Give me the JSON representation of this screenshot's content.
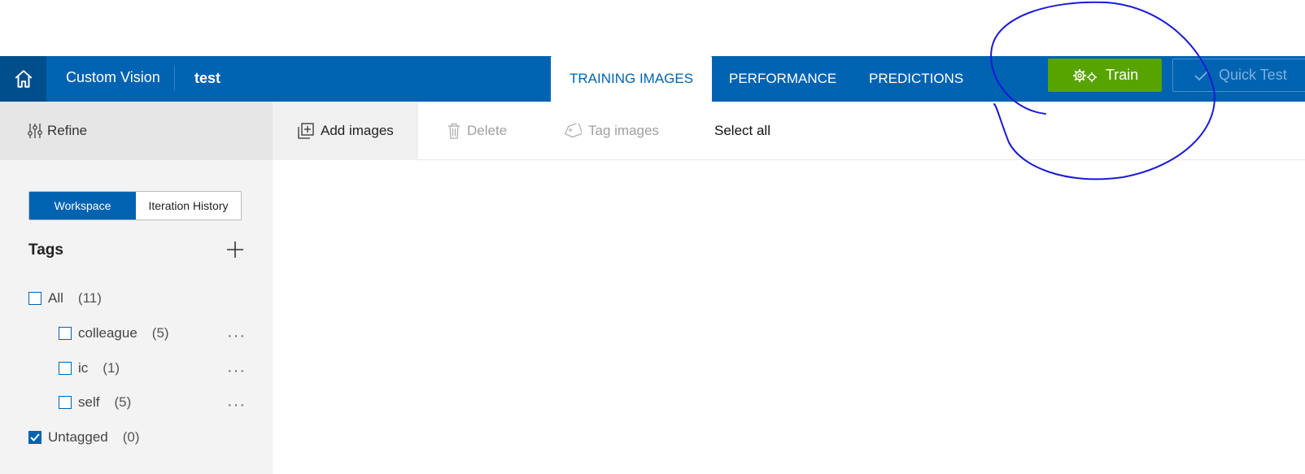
{
  "header": {
    "app_name": "Custom Vision",
    "project_name": "test",
    "tabs": [
      {
        "label": "TRAINING IMAGES",
        "active": true
      },
      {
        "label": "PERFORMANCE",
        "active": false
      },
      {
        "label": "PREDICTIONS",
        "active": false
      }
    ],
    "train_label": "Train",
    "quick_test_label": "Quick Test",
    "train_color": "#57a300",
    "brand_color": "#0063b1"
  },
  "sidebar": {
    "refine_label": "Refine",
    "workspace_label": "Workspace",
    "iteration_history_label": "Iteration History",
    "tags_title": "Tags",
    "tags": [
      {
        "name": "All",
        "count": "(11)",
        "checked": false
      },
      {
        "name": "colleague",
        "count": "(5)",
        "checked": false
      },
      {
        "name": "ic",
        "count": "(1)",
        "checked": false
      },
      {
        "name": "self",
        "count": "(5)",
        "checked": false
      },
      {
        "name": "Untagged",
        "count": "(0)",
        "checked": true
      }
    ]
  },
  "toolbar": {
    "add_images": "Add images",
    "delete": "Delete",
    "tag_images": "Tag images",
    "select_all": "Select all"
  },
  "icons": [
    "home-icon",
    "gear-icon",
    "check-icon",
    "refine-sliders-icon",
    "plus-icon",
    "add-images-icon",
    "trash-icon",
    "tag-icon",
    "more-icon"
  ]
}
